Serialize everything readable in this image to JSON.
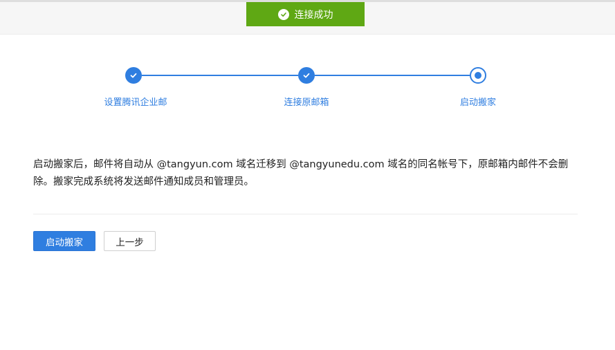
{
  "toast": {
    "icon": "check-circle-icon",
    "text": "连接成功",
    "color": "#5fa814"
  },
  "steps": [
    {
      "label": "设置腾讯企业邮",
      "status": "done"
    },
    {
      "label": "连接原邮箱",
      "status": "done"
    },
    {
      "label": "启动搬家",
      "status": "current"
    }
  ],
  "accent_color": "#2f7ee0",
  "description": "启动搬家后，邮件将自动从 @tangyun.com 域名迁移到 @tangyunedu.com 域名的同名帐号下，原邮箱内邮件不会删除。搬家完成系统将发送邮件通知成员和管理员。",
  "buttons": {
    "start": "启动搬家",
    "previous": "上一步"
  }
}
